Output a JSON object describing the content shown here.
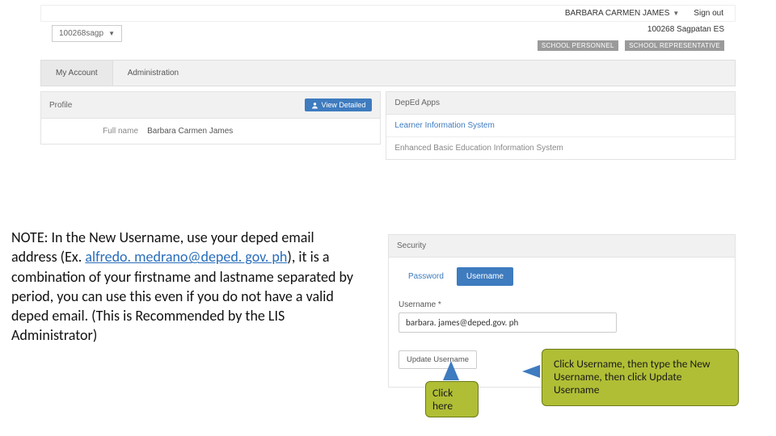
{
  "header": {
    "user": "BARBARA CARMEN JAMES",
    "signout": "Sign out"
  },
  "school": {
    "selector": "100268sagp",
    "code_name": "100268  Sagpatan ES",
    "tags": [
      "SCHOOL PERSONNEL",
      "SCHOOL REPRESENTATIVE"
    ]
  },
  "tabs": {
    "my_account": "My Account",
    "administration": "Administration"
  },
  "profile": {
    "title": "Profile",
    "view_detailed": "View Detailed",
    "fullname_label": "Full name",
    "fullname_value": "Barbara Carmen James"
  },
  "apps": {
    "title": "DepEd Apps",
    "lis": "Learner Information System",
    "ebeis": "Enhanced Basic Education Information System"
  },
  "security": {
    "title": "Security",
    "password_tab": "Password",
    "username_tab": "Username",
    "username_label": "Username *",
    "username_value": "barbara. james@deped.gov. ph",
    "update_btn": "Update Username"
  },
  "note": {
    "lead": "NOTE: In the New Username, use your deped email address (Ex. ",
    "link": "alfredo. medrano@deped. gov. ph",
    "tail": "), it is a combination of your firstname and lastname separated by period, you can use this even if you do not have a valid deped email. (This is Recommended by the LIS Administrator)"
  },
  "callouts": {
    "click_here": "Click here",
    "instructions": "Click Username, then type the New Username, then click Update Username"
  }
}
